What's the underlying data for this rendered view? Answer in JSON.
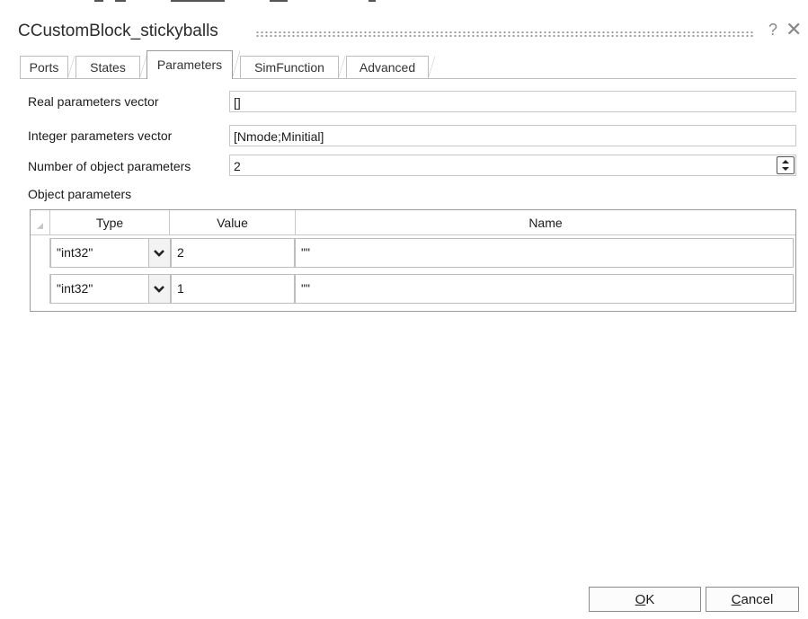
{
  "window": {
    "title": "CCustomBlock_stickyballs",
    "help_glyph": "?",
    "close_glyph": "✕"
  },
  "tabs": [
    {
      "label": "Ports"
    },
    {
      "label": "States"
    },
    {
      "label": "Parameters",
      "active": true
    },
    {
      "label": "SimFunction"
    },
    {
      "label": "Advanced"
    }
  ],
  "form": {
    "real_label": "Real parameters vector",
    "real_value": "[]",
    "integer_label": "Integer parameters vector",
    "integer_value": "[Nmode;Minitial]",
    "numobj_label": "Number of object parameters",
    "numobj_value": "2",
    "objparams_label": "Object parameters"
  },
  "grid": {
    "columns": [
      "Type",
      "Value",
      "Name"
    ],
    "rows": [
      {
        "type": "\"int32\"",
        "value": "2",
        "name": "\"\""
      },
      {
        "type": "\"int32\"",
        "value": "1",
        "name": "\"\""
      }
    ]
  },
  "buttons": {
    "ok_mnemonic": "O",
    "ok_rest": "K",
    "cancel_mnemonic": "C",
    "cancel_rest": "ancel"
  }
}
